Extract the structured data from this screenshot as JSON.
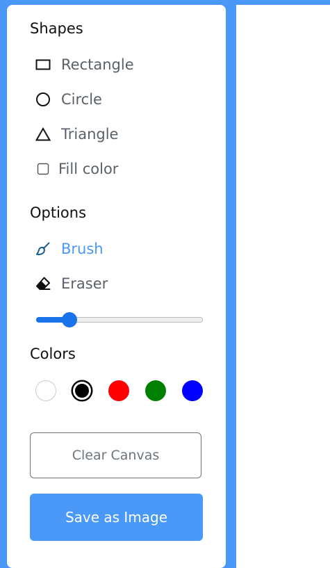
{
  "toolbar": {
    "shapes_title": "Shapes",
    "options_title": "Options",
    "colors_title": "Colors",
    "shapes": [
      {
        "label": "Rectangle",
        "icon": "rectangle-icon"
      },
      {
        "label": "Circle",
        "icon": "circle-icon"
      },
      {
        "label": "Triangle",
        "icon": "triangle-icon"
      }
    ],
    "fill_color_label": "Fill color",
    "fill_color_checked": false,
    "tools": [
      {
        "label": "Brush",
        "icon": "brush-icon",
        "active": true
      },
      {
        "label": "Eraser",
        "icon": "eraser-icon",
        "active": false
      }
    ],
    "brush_size_fraction": 0.17,
    "colors": [
      {
        "value": "#ffffff",
        "selected": false
      },
      {
        "value": "#000000",
        "selected": true
      },
      {
        "value": "#ff0000",
        "selected": false
      },
      {
        "value": "#008000",
        "selected": false
      },
      {
        "value": "#0000ff",
        "selected": false
      }
    ],
    "clear_label": "Clear Canvas",
    "save_label": "Save as Image"
  },
  "theme": {
    "accent": "#4a98f7",
    "slider": "#1a73e8"
  }
}
